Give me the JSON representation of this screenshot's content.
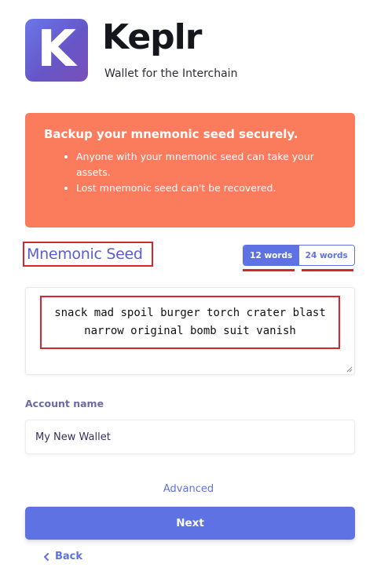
{
  "brand": {
    "logo_letter": "K",
    "name": "Keplr",
    "tagline": "Wallet for the Interchain"
  },
  "warning": {
    "title": "Backup your mnemonic seed securely.",
    "items": [
      "Anyone with your mnemonic seed can take your assets.",
      "Lost mnemonic seed can't be recovered."
    ]
  },
  "mnemonic": {
    "label": "Mnemonic Seed",
    "options": [
      "12 words",
      "24 words"
    ],
    "selected": "12 words",
    "words": "snack mad spoil burger torch crater blast narrow original bomb suit vanish"
  },
  "account": {
    "label": "Account name",
    "value": "My New Wallet"
  },
  "actions": {
    "advanced_label": "Advanced",
    "next_label": "Next",
    "back_label": "Back"
  },
  "colors": {
    "accent": "#5e72e4",
    "warning_bg": "#fb7c5d",
    "highlight": "#d6262f"
  },
  "icons": {
    "back": "chevron-left-icon",
    "resize": "resize-grip-icon"
  }
}
